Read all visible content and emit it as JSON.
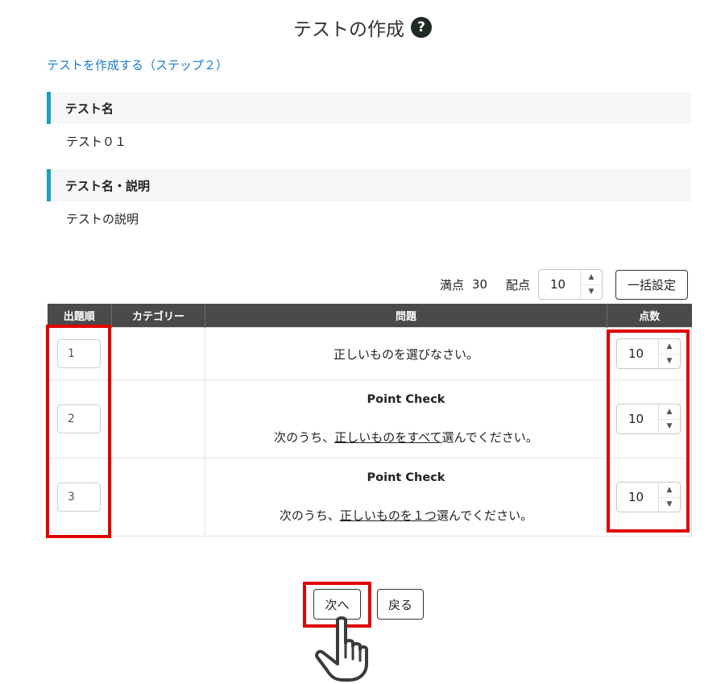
{
  "page": {
    "title": "テストの作成",
    "help_icon": "?",
    "step_link": "テストを作成する（ステップ２）"
  },
  "sections": [
    {
      "label": "テスト名",
      "value": "テスト０１"
    },
    {
      "label": "テスト名・説明",
      "value": "テストの説明"
    }
  ],
  "toolbar": {
    "full_score_label": "満点",
    "full_score_value": "30",
    "points_label": "配点",
    "points_value": "10",
    "bulk_set_label": "一括設定"
  },
  "table": {
    "headers": [
      "出題順",
      "カテゴリー",
      "問題",
      "点数"
    ],
    "rows": [
      {
        "order": "1",
        "category": "",
        "question_title": "",
        "q_pre": "正しいものを選びなさい。",
        "q_under": "",
        "q_post": "",
        "score": "10"
      },
      {
        "order": "2",
        "category": "",
        "question_title": "Point Check",
        "q_pre": "次のうち、",
        "q_under": "正しいものをすべて",
        "q_post": "選んでください。",
        "score": "10"
      },
      {
        "order": "3",
        "category": "",
        "question_title": "Point Check",
        "q_pre": "次のうち、",
        "q_under": "正しいものを１つ",
        "q_post": "選んでください。",
        "score": "10"
      }
    ]
  },
  "buttons": {
    "next_label": "次へ",
    "back_label": "戻る"
  },
  "icons": {
    "help": "help-circle-icon",
    "pointer": "hand-pointer-icon",
    "stepper_up": "▲",
    "stepper_down": "▼"
  },
  "colors": {
    "accent_bar": "#1aa2b8",
    "link": "#1a7bc6",
    "table_header": "#4a4a4a",
    "highlight": "#e00000"
  }
}
